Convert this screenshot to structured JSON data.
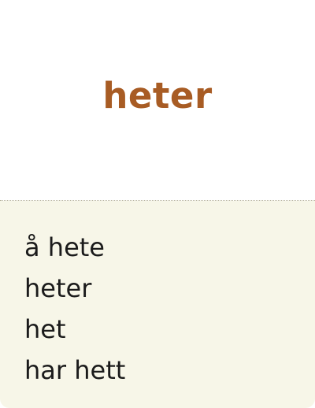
{
  "card": {
    "headword": "heter",
    "forms": [
      "å hete",
      "heter",
      "het",
      "har hett"
    ]
  },
  "colors": {
    "headword": "#a85c24",
    "top_background": "#ffffff",
    "bottom_background": "#f7f6e8",
    "forms_text": "#1b1b1b"
  }
}
